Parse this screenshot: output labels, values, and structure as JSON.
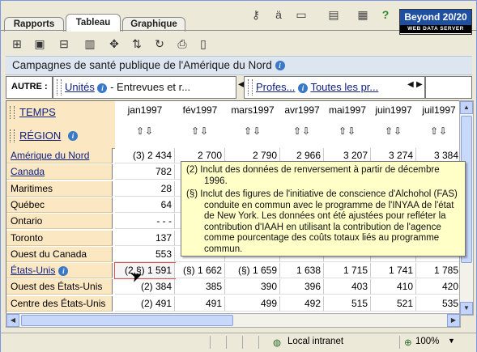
{
  "tabs": [
    {
      "label": "Rapports",
      "active": false
    },
    {
      "label": "Tableau",
      "active": true
    },
    {
      "label": "Graphique",
      "active": false
    }
  ],
  "top_icons": [
    "key-icon",
    "language-icon",
    "folder-icon",
    "window-icon",
    "spellcheck-icon",
    "help-icon"
  ],
  "logo": {
    "line1": "Beyond 20/20",
    "line2": "WEB DATA SERVER"
  },
  "toolbar_icons": [
    "pivot-icon",
    "table-icon",
    "open-folder-icon",
    "column-icon",
    "move-icon",
    "sort-icon",
    "refresh-icon",
    "printer-icon",
    "clipboard-icon"
  ],
  "title": "Campagnes de santé publique de l'Amérique du Nord",
  "autre": {
    "label": "AUTRE :",
    "dim1_name": "Unités",
    "dim1_value": "- Entrevues et r...",
    "dim2_name": "Profes...",
    "dim2_value": "Toutes les pr..."
  },
  "axes": {
    "temps": "TEMPS",
    "region": "RÉGION"
  },
  "columns": [
    "jan1997",
    "fév1997",
    "mars1997",
    "avr1997",
    "mai1997",
    "juin1997",
    "juil1997"
  ],
  "sort_glyph": "⇧⇩",
  "rows": [
    {
      "label": "Amérique du Nord",
      "link": true,
      "info": false,
      "values": [
        "(3) 2 434",
        "2 700",
        "2 790",
        "2 966",
        "3 207",
        "3 274",
        "3 384"
      ]
    },
    {
      "label": "Canada",
      "link": true,
      "info": false,
      "values": [
        "782",
        "",
        "",
        "",
        "",
        "",
        ""
      ]
    },
    {
      "label": "Maritimes",
      "link": false,
      "info": false,
      "values": [
        "28",
        "",
        "",
        "",
        "",
        "",
        ""
      ]
    },
    {
      "label": "Québec",
      "link": false,
      "info": false,
      "values": [
        "64",
        "",
        "",
        "",
        "",
        "",
        ""
      ]
    },
    {
      "label": "Ontario",
      "link": false,
      "info": false,
      "values": [
        "- - -",
        "",
        "",
        "",
        "",
        "",
        ""
      ]
    },
    {
      "label": "Toronto",
      "link": false,
      "info": false,
      "values": [
        "137",
        "",
        "",
        "",
        "",
        "",
        ""
      ]
    },
    {
      "label": "Ouest du Canada",
      "link": false,
      "info": false,
      "values": [
        "553",
        "",
        "",
        "",
        "",
        "",
        ""
      ]
    },
    {
      "label": "États-Unis",
      "link": true,
      "info": true,
      "values": [
        "(2,§) 1 591",
        "(§) 1 662",
        "(§) 1 659",
        "1 638",
        "1 715",
        "1 741",
        "1 785"
      ]
    },
    {
      "label": "Ouest des États-Unis",
      "link": false,
      "info": false,
      "values": [
        "(2) 384",
        "385",
        "390",
        "396",
        "403",
        "410",
        "420"
      ]
    },
    {
      "label": "Centre des États-Unis",
      "link": false,
      "info": false,
      "values": [
        "(2) 491",
        "491",
        "499",
        "492",
        "515",
        "521",
        "535"
      ]
    }
  ],
  "tooltip": {
    "note1_mark": "(2)",
    "note1_text": "Inclut des données de renversement à partir de décembre 1996.",
    "note2_mark": "(§)",
    "note2_text": "Inclut des figures de l'initiative de conscience d'Alchohol (FAS) conduite en commun avec le programme de l'INYAA de l'état de New York. Les données ont été ajustées pour refléter la contribution d'IAAH en utilisant la contribution de l'agence comme pourcentage des coûts totaux liés au programme commun."
  },
  "status": {
    "zone": "Local intranet",
    "zoom": "100%"
  }
}
